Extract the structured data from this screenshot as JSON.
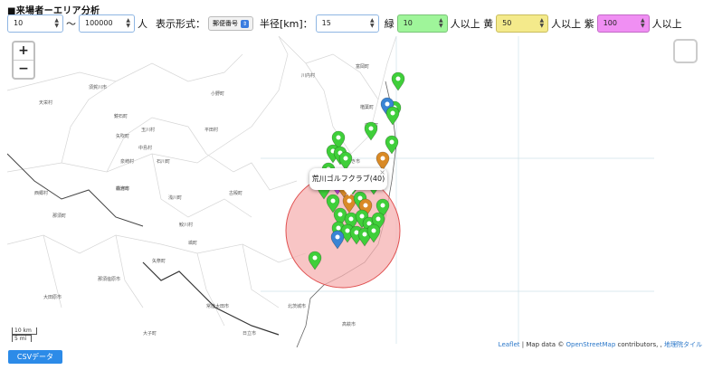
{
  "header": {
    "title": "■来場者ーエリア分析"
  },
  "filters": {
    "min_value": "10",
    "tilde": "〜",
    "max_value": "100000",
    "unit": "人",
    "display_label": "表示形式：",
    "display_select": "郵便番号",
    "radius_label": "半径[km]：",
    "radius_value": "15",
    "green_label": "緑",
    "green_value": "10",
    "green_suffix": "人以上 黄",
    "yellow_value": "50",
    "yellow_suffix": "人以上 紫",
    "purple_value": "100",
    "purple_suffix": "人以上"
  },
  "map": {
    "zoom_in": "+",
    "zoom_out": "−",
    "scale_km": "10 km",
    "scale_mi": "5 mi",
    "popup_text": "荒川ゴルフクラブ(40)",
    "popup_close": "×",
    "attribution": {
      "leaflet": "Leaflet",
      "map_data": " | Map data © ",
      "osm": "OpenStreetMap",
      "contributors": " contributors, , ",
      "gsi": "地理院タイル"
    },
    "colors": {
      "green": "#3fcf3a",
      "orange": "#d98a26",
      "blue": "#3a84d4",
      "purple": "#b844d6",
      "circle_fill": "#f6b1b1",
      "circle_stroke": "#e05050"
    },
    "place_labels": [
      "須賀川市",
      "天栄村",
      "鏡石町",
      "玉川村",
      "矢吹町",
      "中島村",
      "泉崎村",
      "石川町",
      "平田村",
      "小野町",
      "川内村",
      "富岡町",
      "楢葉町",
      "広野町",
      "いわき市",
      "古殿町",
      "浅川町",
      "棚倉町",
      "鮫川村",
      "塙町",
      "矢祭町",
      "白河市",
      "西郷村",
      "那須町",
      "大田原市",
      "大子町",
      "常陸太田市",
      "北茨城市",
      "高萩市",
      "日立市",
      "那須塩原市"
    ]
  },
  "csv_button": "CSVデータ"
}
